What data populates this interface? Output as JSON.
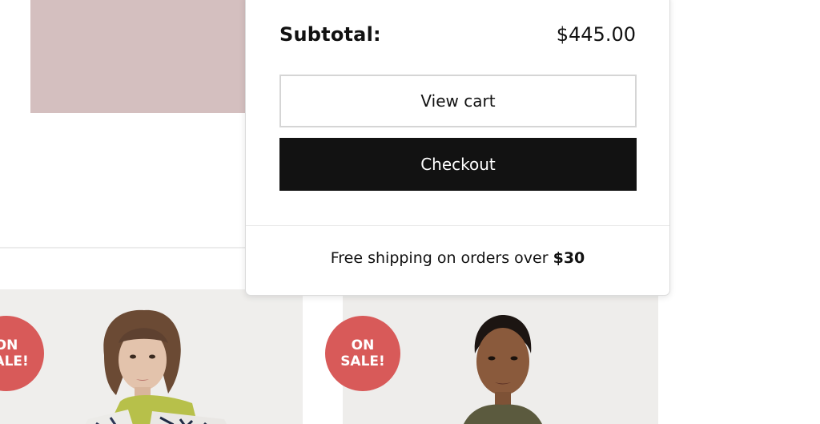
{
  "cart": {
    "subtotal_label": "Subtotal:",
    "subtotal_amount": "$445.00",
    "view_cart_label": "View cart",
    "checkout_label": "Checkout",
    "shipping_text": "Free shipping on orders over",
    "shipping_threshold": "$30"
  },
  "products": [
    {
      "badge_line1": "ON",
      "badge_line2": "SALE!"
    },
    {
      "badge_line1": "ON",
      "badge_line2": "SALE!"
    }
  ],
  "colors": {
    "badge": "#d85a59",
    "checkout_bg": "#121212",
    "hero_tile": "#d4bfbf"
  }
}
